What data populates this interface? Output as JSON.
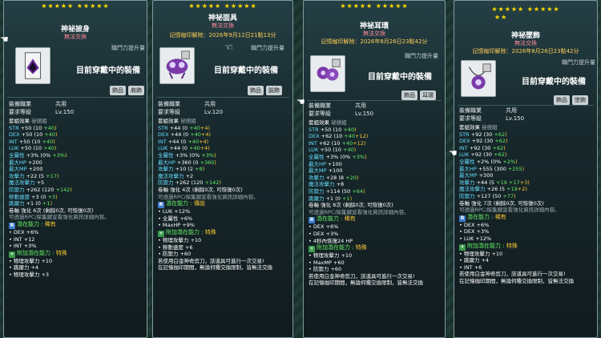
{
  "common": {
    "upgrade_label": "職門力提升量",
    "wearing_label": "目前穿戴中的裝備",
    "job_key": "裝備職業",
    "job_val": "共用",
    "level_key": "要求等級",
    "set_label": "套組效果",
    "set_name": "祕憩組",
    "trade_none": "無法交換",
    "seal_prefix": "記憶枷印解除：",
    "scroll_hint": "可透過RPC/探集鍵宣看強化資訊詳細內容。",
    "scissors_note": "若使用白金神奇剪刀，該道具可進行一次交易!",
    "seal_note": "在記憶枷印期間，無論何種交換限制，皆無法交換",
    "potential_label": "潛在能力",
    "bonus_potential_label": "附加潛在能力"
  },
  "cards": [
    {
      "stars": "★★★★★ ★★★★★",
      "name": "神祕披身",
      "trade": "無法交換",
      "seal": "",
      "tags": [
        "飾品",
        "肩飾"
      ],
      "level": "Lv.150",
      "stats": [
        [
          "STR",
          "+50",
          "(10 ",
          "+40",
          ")"
        ],
        [
          "DEX",
          "+50",
          "(10 ",
          "+40",
          ")"
        ],
        [
          "INT",
          "+50",
          "(10 ",
          "+40",
          ")"
        ],
        [
          "LUK",
          "+50",
          "(10 ",
          "+40",
          ")"
        ],
        [
          "全屬性",
          "+3%",
          "(0% ",
          "+3%",
          ")"
        ],
        [
          "最大HP",
          "+200",
          "",
          "",
          ""
        ],
        [
          "最大MP",
          "+200",
          "",
          "",
          ""
        ],
        [
          "攻擊力",
          "+22",
          "(5 ",
          "+17",
          ")"
        ],
        [
          "魔法攻擊力",
          "+5",
          "",
          "",
          ""
        ],
        [
          "防禦力",
          "+262",
          "(120 ",
          "+142",
          ")"
        ],
        [
          "移動速度",
          "+3",
          "(0 ",
          "+3",
          ")"
        ],
        [
          "跳躍力",
          "+1",
          "(0 ",
          "+1",
          ")"
        ]
      ],
      "scroll": "卷軸 強化 6次 (剩餘0次, 可恢復0次)",
      "potential_grade": "稀有",
      "potential": [
        "DEX +6%",
        "INT +12",
        "INT +3%"
      ],
      "bonus_grade": "特殊",
      "bonus": [
        "物理攻擊力 +10",
        "跳躍力 +4",
        "物理攻擊力 +3"
      ]
    },
    {
      "stars": "★★★★★ ★★★★★",
      "name": "神祕面具",
      "trade": "無法交換",
      "seal": "2026年9月12日21點13分",
      "tags": [
        "飾品",
        "臉飾"
      ],
      "level": "Lv.120",
      "stats": [
        [
          "STR",
          "+44",
          "(0 ",
          "+40",
          "+4)"
        ],
        [
          "DEX",
          "+44",
          "(0 ",
          "+40",
          "+4)"
        ],
        [
          "INT",
          "+44",
          "(0 ",
          "+40",
          "+4)"
        ],
        [
          "LUK",
          "+44",
          "(0 ",
          "+40",
          "+4)"
        ],
        [
          "全屬性",
          "+3%",
          "(0% ",
          "+3%",
          ")"
        ],
        [
          "最大HP",
          "+360",
          "(0 ",
          "+360",
          ")"
        ],
        [
          "攻擊力",
          "+10",
          "(2 ",
          "+8",
          ")"
        ],
        [
          "魔法攻擊力",
          "+2",
          "",
          "",
          ""
        ],
        [
          "防禦力",
          "+262",
          "(120 ",
          "+142",
          ")"
        ]
      ],
      "scroll": "卷軸 強化 4次 (剩餘0次, 可恢復0次)",
      "potential_grade": "傳說",
      "potential": [
        "LUK +12%",
        "全屬性 +6%",
        "MaxHP +9%"
      ],
      "bonus_grade": "特殊",
      "bonus": [
        "物理攻擊力 +10",
        "移動速度 +6",
        "防禦力 +60"
      ]
    },
    {
      "stars": "★★★★★ ★★★★★",
      "name": "神祕耳環",
      "trade": "無法交換",
      "seal": "2026年8月26日23點42分",
      "tags": [
        "飾品",
        "耳環"
      ],
      "level": "Lv.150",
      "stats": [
        [
          "STR",
          "+50",
          "(10 ",
          "+40",
          ")"
        ],
        [
          "DEX",
          "+62",
          "(10 ",
          "+40",
          "+12)"
        ],
        [
          "INT",
          "+62",
          "(10 ",
          "+40",
          "+12)"
        ],
        [
          "LUK",
          "+50",
          "(10 ",
          "+40",
          ")"
        ],
        [
          "全屬性",
          "+3%",
          "(0% ",
          "+3%",
          ")"
        ],
        [
          "最大HP",
          "+100",
          "",
          "",
          ""
        ],
        [
          "最大MP",
          "+100",
          "",
          "",
          ""
        ],
        [
          "攻擊力",
          "+28",
          "(8 ",
          "+20",
          ")"
        ],
        [
          "魔法攻擊力",
          "+8",
          "",
          "",
          ""
        ],
        [
          "防禦力",
          "+114",
          "(50 ",
          "+64",
          ")"
        ],
        [
          "跳躍力",
          "+1",
          "(0 ",
          "+1",
          ")"
        ]
      ],
      "scroll": "卷軸 強化 8次 (剩餘0次, 可恢復0次)",
      "potential_grade": "稀有",
      "potential": [
        "DEX +6%",
        "DEX +3%",
        "4秒內恢復24 HP"
      ],
      "bonus_grade": "特殊",
      "bonus": [
        "物理攻擊力 +10",
        "MaxMP +60",
        "防禦力 +60"
      ]
    },
    {
      "stars": "★★★★★ ★★★★★",
      "stars2": "★★",
      "name": "神祕墜飾",
      "trade": "無法交換",
      "seal": "2026年8月26日23點42分",
      "tags": [
        "飾品",
        "墜飾"
      ],
      "level": "Lv.150",
      "stats": [
        [
          "STR",
          "+92",
          "(30 ",
          "+62",
          ")"
        ],
        [
          "DEX",
          "+92",
          "(30 ",
          "+62",
          ")"
        ],
        [
          "INT",
          "+92",
          "(30 ",
          "+62",
          ")"
        ],
        [
          "LUK",
          "+92",
          "(30 ",
          "+62",
          ")"
        ],
        [
          "全屬性",
          "+2%",
          "(0% ",
          "+2%",
          ")"
        ],
        [
          "最大HP",
          "+555",
          "(300 ",
          "+255",
          ")"
        ],
        [
          "最大MP",
          "+300",
          "",
          "",
          ""
        ],
        [
          "攻擊力",
          "+44",
          "(5 ",
          "+19 +17",
          "+3)"
        ],
        [
          "魔法攻擊力",
          "+26",
          "(5 ",
          "+19",
          "+2)"
        ],
        [
          "防禦力",
          "+127",
          "(50 ",
          "+77",
          ")"
        ]
      ],
      "scroll": "卷軸 強化 7次 (剩餘0次, 可恢復0次)",
      "potential_grade": "稀有",
      "potential": [
        "DEX +6%",
        "DEX +3%",
        "LUK +12%"
      ],
      "bonus_grade": "特殊",
      "bonus": [
        "物理攻擊力 +10",
        "跳躍力 +4",
        "INT +6"
      ]
    }
  ]
}
